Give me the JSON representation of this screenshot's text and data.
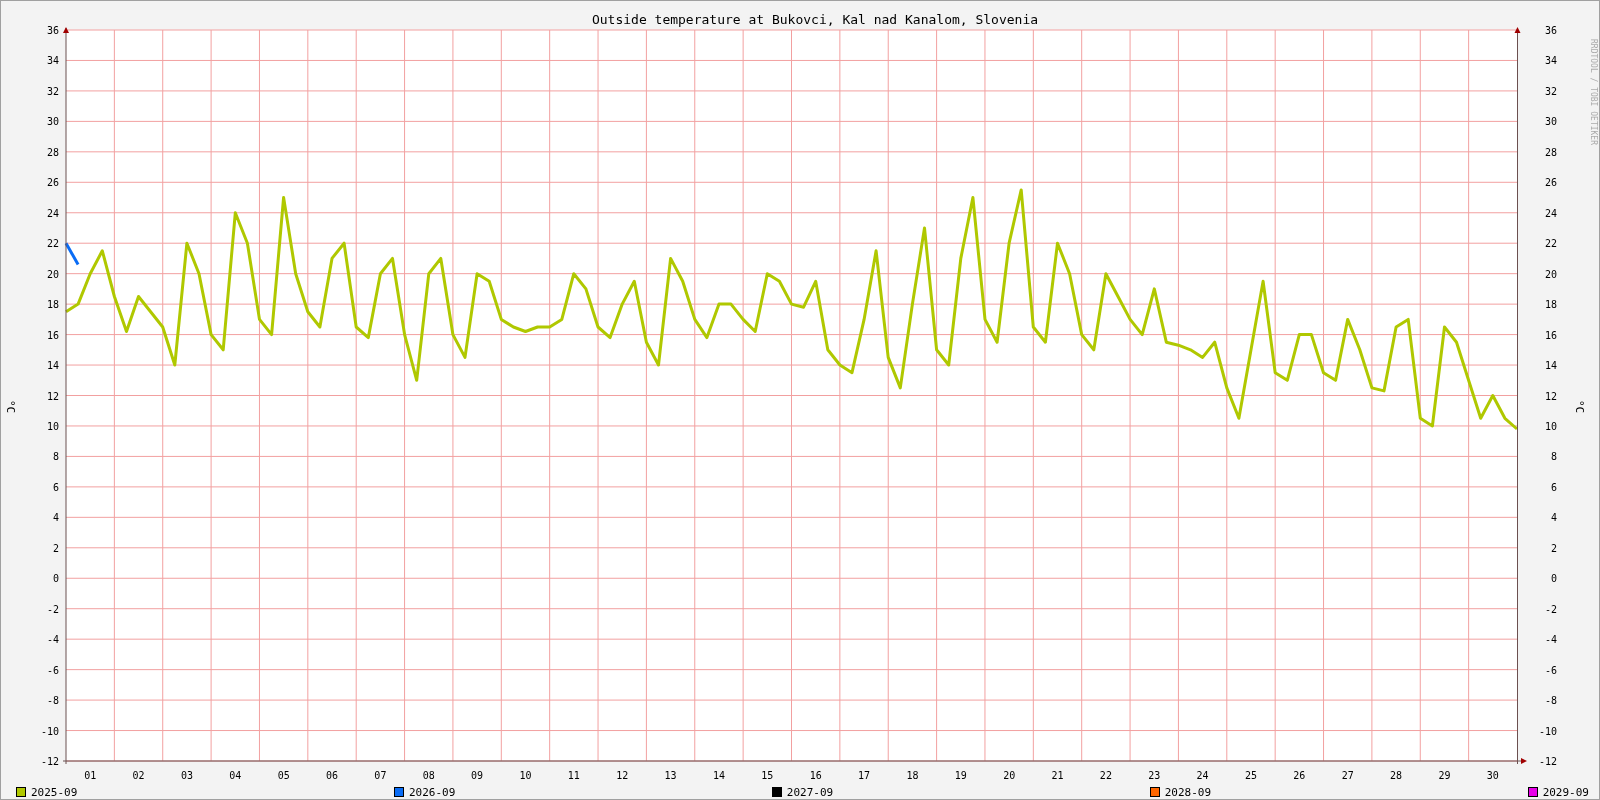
{
  "chart": {
    "title": "Outside temperature at Bukovci, Kal nad Kanalom, Slovenia",
    "chart_data": {
      "type": "line",
      "ylabel": "°C",
      "xlim": [
        0.5,
        30.5
      ],
      "ylim": [
        -12,
        36
      ],
      "x": [
        0.5,
        0.75,
        1,
        1.25,
        1.5,
        1.75,
        2,
        2.25,
        2.5,
        2.75,
        3,
        3.25,
        3.5,
        3.75,
        4,
        4.25,
        4.5,
        4.75,
        5,
        5.25,
        5.5,
        5.75,
        6,
        6.25,
        6.5,
        6.75,
        7,
        7.25,
        7.5,
        7.75,
        8,
        8.25,
        8.5,
        8.75,
        9,
        9.25,
        9.5,
        9.75,
        10,
        10.25,
        10.5,
        10.75,
        11,
        11.25,
        11.5,
        11.75,
        12,
        12.25,
        12.5,
        12.75,
        13,
        13.25,
        13.5,
        13.75,
        14,
        14.25,
        14.5,
        14.75,
        15,
        15.25,
        15.5,
        15.75,
        16,
        16.25,
        16.5,
        16.75,
        17,
        17.25,
        17.5,
        17.75,
        18,
        18.25,
        18.5,
        18.75,
        19,
        19.25,
        19.5,
        19.75,
        20,
        20.25,
        20.5,
        20.75,
        21,
        21.25,
        21.5,
        21.75,
        22,
        22.25,
        22.5,
        22.75,
        23,
        23.25,
        23.5,
        23.75,
        24,
        24.25,
        24.5,
        24.75,
        25,
        25.25,
        25.5,
        25.75,
        26,
        26.25,
        26.5,
        26.75,
        27,
        27.25,
        27.5,
        27.75,
        28,
        28.25,
        28.5,
        28.75,
        29,
        29.25,
        29.5,
        29.75,
        30,
        30.25,
        30.5
      ],
      "grid": true,
      "xticks": [
        {
          "value": 1,
          "label": "01"
        },
        {
          "value": 2,
          "label": "02"
        },
        {
          "value": 3,
          "label": "03"
        },
        {
          "value": 4,
          "label": "04"
        },
        {
          "value": 5,
          "label": "05"
        },
        {
          "value": 6,
          "label": "06"
        },
        {
          "value": 7,
          "label": "07"
        },
        {
          "value": 8,
          "label": "08"
        },
        {
          "value": 9,
          "label": "09"
        },
        10,
        11,
        12,
        13,
        14,
        15,
        16,
        17,
        18,
        19,
        20,
        21,
        22,
        23,
        24,
        25,
        26,
        27,
        28,
        29,
        30
      ],
      "yticks": [
        36,
        34,
        32,
        30,
        28,
        26,
        24,
        22,
        20,
        18,
        16,
        14,
        12,
        10,
        8,
        6,
        4,
        2,
        0,
        -2,
        -4,
        -6,
        -8,
        -10,
        -12
      ],
      "series": [
        {
          "name": "2025-09",
          "color": "#b0c800",
          "values": [
            17.5,
            18,
            20,
            21.5,
            18.5,
            16.2,
            18.5,
            17.5,
            16.5,
            14,
            22,
            20,
            16,
            15,
            24,
            22,
            17,
            16,
            25,
            20,
            17.5,
            16.5,
            21,
            22,
            16.5,
            15.8,
            20,
            21,
            16,
            13,
            20,
            21,
            16,
            14.5,
            20,
            19.5,
            17,
            16.5,
            16.2,
            16.5,
            16.5,
            17,
            20,
            19,
            16.5,
            15.8,
            18,
            19.5,
            15.5,
            14,
            21,
            19.5,
            17,
            15.8,
            18,
            18,
            17,
            16.2,
            20,
            19.5,
            18,
            17.8,
            19.5,
            15,
            14,
            13.5,
            17,
            21.5,
            14.5,
            12.5,
            18,
            23,
            15,
            14,
            21,
            25,
            17,
            15.5,
            22,
            25.5,
            16.5,
            15.5,
            22,
            20,
            16,
            15,
            20,
            18.5,
            17,
            16,
            19,
            15.5,
            15.3,
            15,
            14.5,
            15.5,
            12.5,
            10.5,
            15,
            19.5,
            13.5,
            13,
            16,
            16,
            13.5,
            13,
            17,
            15,
            12.5,
            12.3,
            16.5,
            17,
            10.5,
            10,
            16.5,
            15.5,
            13,
            10.5,
            12,
            10.5,
            9.8
          ]
        },
        {
          "name": "2026-09",
          "color": "#0a6cf5",
          "values": [
            22,
            20.6,
            null,
            null,
            null,
            null,
            null,
            null,
            null,
            null,
            null,
            null,
            null,
            null,
            null,
            null,
            null,
            null,
            null,
            null,
            null,
            null,
            null,
            null,
            null,
            null,
            null,
            null,
            null,
            null,
            null,
            null,
            null,
            null,
            null,
            null,
            null,
            null,
            null,
            null,
            null,
            null,
            null,
            null,
            null,
            null,
            null,
            null,
            null,
            null,
            null,
            null,
            null,
            null,
            null,
            null,
            null,
            null,
            null,
            null,
            null,
            null,
            null,
            null,
            null,
            null,
            null,
            null,
            null,
            null,
            null,
            null,
            null,
            null,
            null,
            null,
            null,
            null,
            null,
            null,
            null,
            null,
            null,
            null,
            null,
            null,
            null,
            null,
            null,
            null,
            null,
            null,
            null,
            null,
            null,
            null,
            null,
            null,
            null,
            null,
            null,
            null,
            null,
            null,
            null,
            null,
            null,
            null,
            null,
            null,
            null,
            null,
            null,
            null,
            null,
            null,
            null,
            null,
            null,
            null,
            null
          ]
        }
      ]
    },
    "left_axis": {
      "ticks": [
        "36",
        "34",
        "32",
        "30",
        "28",
        "26",
        "24",
        "22",
        "20",
        "18",
        "16",
        "14",
        "12",
        "10",
        "8",
        "6",
        "4",
        "2",
        "0",
        "-2",
        "-4",
        "-6",
        "-8",
        "-10",
        "-12"
      ]
    },
    "right_axis": {
      "label": "°C",
      "ticks": [
        "36",
        "34",
        "32",
        "30",
        "28",
        "26",
        "24",
        "22",
        "20",
        "18",
        "16",
        "14",
        "12",
        "10",
        "8",
        "6",
        "4",
        "2",
        "0",
        "-2",
        "-4",
        "-6",
        "-8",
        "-10",
        "-12"
      ]
    },
    "credit": "RRDTOOL / TOBI OETIKER",
    "legend_extra": [
      {
        "label": "2027-09",
        "color": "#000000"
      },
      {
        "label": "2028-09",
        "color": "#ff6600"
      },
      {
        "label": "2029-09",
        "color": "#e800e8"
      }
    ]
  }
}
